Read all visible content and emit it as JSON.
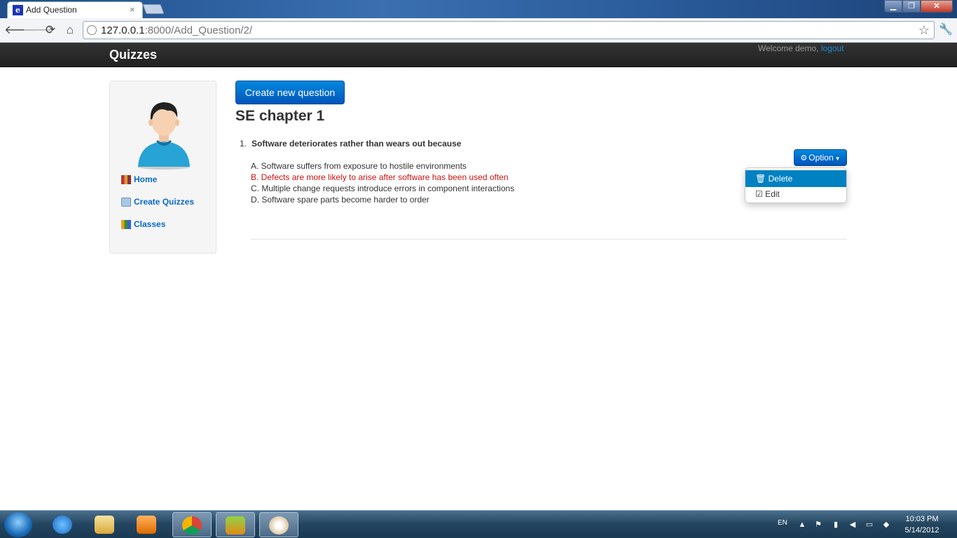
{
  "browser": {
    "tab_title": "Add Question",
    "tab_favicon_letter": "e",
    "tab_close": "×",
    "url_host": "127.0.0.1",
    "url_path": ":8000/Add_Question/2/",
    "icons": {
      "back": "back-arrow-icon",
      "forward": "forward-arrow-icon",
      "reload": "reload-icon",
      "home": "home-icon",
      "bookmark": "star-icon",
      "menu": "wrench-icon"
    }
  },
  "navbar": {
    "brand": "Quizzes",
    "welcome_text": "Welcome demo, ",
    "logout_label": "logout"
  },
  "sidebar": {
    "items": [
      {
        "label": "Home",
        "icon": "books-icon"
      },
      {
        "label": "Create Quizzes",
        "icon": "folder-icon"
      },
      {
        "label": "Classes",
        "icon": "chart-icon"
      }
    ]
  },
  "main": {
    "create_button": "Create new question",
    "quiz_title": "SE chapter 1",
    "questions": [
      {
        "number": "1.",
        "text": "Software deteriorates rather than wears out because",
        "answers": [
          {
            "label": "A. Software suffers from exposure to hostile environments",
            "correct": false
          },
          {
            "label": "B. Defects are more likely to arise after software has been used often",
            "correct": true
          },
          {
            "label": "C. Multiple change requests introduce errors in component interactions",
            "correct": false
          },
          {
            "label": "D. Software spare parts become harder to order",
            "correct": false
          }
        ],
        "option_button": "Option",
        "option_menu": [
          {
            "label": "Delete",
            "icon": "trash-icon",
            "highlighted": true
          },
          {
            "label": "Edit",
            "icon": "edit-icon",
            "highlighted": false
          }
        ]
      }
    ]
  },
  "taskbar": {
    "language": "EN",
    "time": "10:03 PM",
    "date": "5/14/2012"
  },
  "colors": {
    "accent": "#0081c2",
    "correct_answer": "#cc1111",
    "navbar": "#222222"
  }
}
